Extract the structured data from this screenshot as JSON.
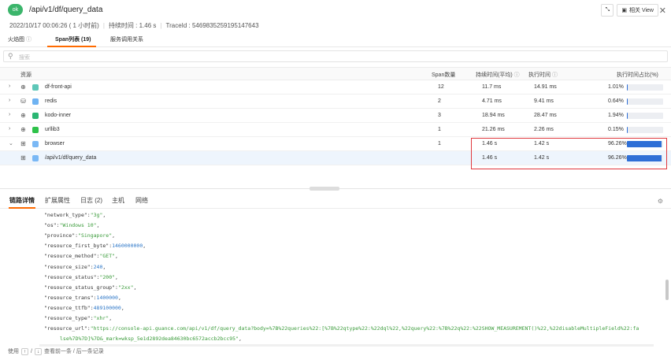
{
  "header": {
    "status_badge": "ok",
    "title": "/api/v1/df/query_data",
    "datetime": "2022/10/17 00:06:26 ( 1 小时前)",
    "duration": "持续时间 : 1.46 s",
    "trace_id": "TraceId : 5469835259195147643",
    "related_view_label": "相关 View"
  },
  "top_tabs": [
    {
      "label": "火焰图"
    },
    {
      "label": "Span列表 (19)"
    },
    {
      "label": "服务调用关系"
    }
  ],
  "search": {
    "placeholder": "搜索"
  },
  "table": {
    "columns": {
      "resource": "资源",
      "span_count": "Span数量",
      "duration_avg": "持续时间(平均)",
      "exec_time": "执行时间",
      "exec_pct": "执行时间占比(%)"
    },
    "rows": [
      {
        "name": "df-front-api",
        "count": "12",
        "duration": "11.7 ms",
        "exec": "14.91 ms",
        "pct": "1.01%",
        "pct_value": 1.01,
        "color": "#5ec7b8",
        "icon": "globe-icon"
      },
      {
        "name": "redis",
        "count": "2",
        "duration": "4.71 ms",
        "exec": "9.41 ms",
        "pct": "0.64%",
        "pct_value": 0.64,
        "color": "#6fb3f2",
        "icon": "database-icon"
      },
      {
        "name": "kodo-inner",
        "count": "3",
        "duration": "18.94 ms",
        "exec": "28.47 ms",
        "pct": "1.94%",
        "pct_value": 1.94,
        "color": "#2ab673",
        "icon": "globe-icon"
      },
      {
        "name": "urllib3",
        "count": "1",
        "duration": "21.26 ms",
        "exec": "2.26 ms",
        "pct": "0.15%",
        "pct_value": 0.15,
        "color": "#2ec24a",
        "icon": "globe-icon"
      },
      {
        "name": "browser",
        "count": "1",
        "duration": "1.46 s",
        "exec": "1.42 s",
        "pct": "96.26%",
        "pct_value": 96.26,
        "color": "#7ab8f5",
        "icon": "browser-icon"
      },
      {
        "name": "/api/v1/df/query_data",
        "count": "",
        "duration": "1.46 s",
        "exec": "1.42 s",
        "pct": "96.26%",
        "pct_value": 96.26,
        "color": "#7ab8f5",
        "icon": "browser-icon"
      }
    ]
  },
  "detail_tabs": [
    {
      "label": "链路详情"
    },
    {
      "label": "扩展属性"
    },
    {
      "label": "日志 (2)"
    },
    {
      "label": "主机"
    },
    {
      "label": "网络"
    }
  ],
  "code_lines": [
    {
      "key": "\"network_type\"",
      "val": "\"3g\"",
      "type": "str"
    },
    {
      "key": "\"os\"",
      "val": "\"Windows 10\"",
      "type": "str"
    },
    {
      "key": "\"province\"",
      "val": "\"Singapore\"",
      "type": "str"
    },
    {
      "key": "\"resource_first_byte\"",
      "val": "1460000000",
      "type": "num"
    },
    {
      "key": "\"resource_method\"",
      "val": "\"GET\"",
      "type": "str"
    },
    {
      "key": "\"resource_size\"",
      "val": "240",
      "type": "num"
    },
    {
      "key": "\"resource_status\"",
      "val": "\"200\"",
      "type": "str"
    },
    {
      "key": "\"resource_status_group\"",
      "val": "\"2xx\"",
      "type": "str"
    },
    {
      "key": "\"resource_trans\"",
      "val": "1400000",
      "type": "num"
    },
    {
      "key": "\"resource_ttfb\"",
      "val": "489100000",
      "type": "num"
    },
    {
      "key": "\"resource_type\"",
      "val": "\"xhr\"",
      "type": "str"
    },
    {
      "key": "\"resource_url\"",
      "val": "\"https://console-api.guance.com/api/v1/df/query_data?body=%7B%22queries%22:[%7B%22qtype%22:%22dql%22,%22query%22:%7B%22q%22:%22SHOW_MEASUREMENT()%22,%22disableMultipleField%22:fa",
      "type": "str"
    },
    {
      "key": "",
      "val": "lse%7D%7D]%7D&_mark=wksp_5e1d2892dea84630bc6572accb2bcc95\"",
      "type": "str"
    }
  ],
  "footer": {
    "prefix": "使用",
    "up_key": "↑",
    "slash": "/",
    "down_key": "↓",
    "suffix": "查看前一条 / 后一条记录"
  }
}
